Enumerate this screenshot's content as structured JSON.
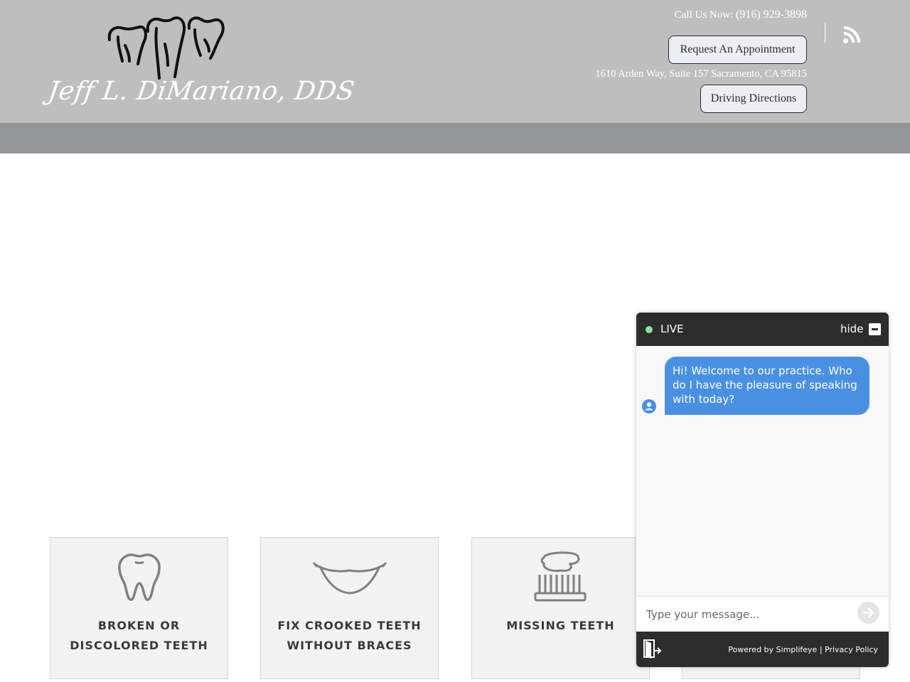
{
  "header": {
    "logo_text": "Jeff L. DiMariano, DDS",
    "call_label": "Call Us Now:",
    "phone": "(916) 929-3898",
    "appointment_button": "Request An Appointment",
    "address": "1610 Arden Way, Suite 157 Sacramento, CA 95815",
    "directions_button": "Driving Directions",
    "rss_icon": "rss-icon"
  },
  "services": [
    {
      "title": "BROKEN OR DISCOLORED TEETH",
      "icon": "tooth-icon"
    },
    {
      "title": "FIX CROOKED TEETH WITHOUT BRACES",
      "icon": "smile-icon"
    },
    {
      "title": "MISSING TEETH",
      "icon": "toothbrush-icon"
    }
  ],
  "chat": {
    "status": "LIVE",
    "hide_label": "hide",
    "welcome_message": "Hi! Welcome to our practice.  Who do I have the pleasure of speaking with today?",
    "input_placeholder": "Type your message...",
    "powered_by": "Powered by Simplifeye",
    "separator": "|",
    "privacy_policy": "Privacy Policy"
  },
  "colors": {
    "header_bg": "#bebebf",
    "nav_bg": "#959698",
    "chat_dark": "#2d2d2d",
    "chat_bubble": "#4a90e2",
    "live_indicator": "#8fe28f"
  }
}
